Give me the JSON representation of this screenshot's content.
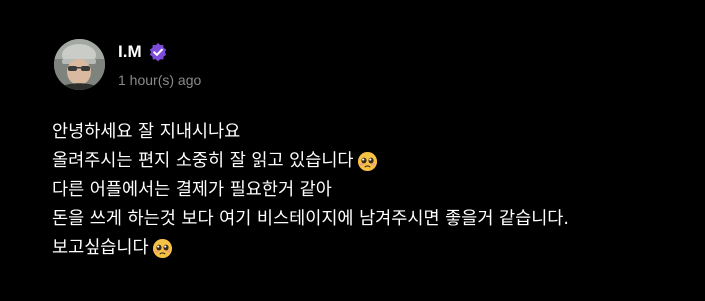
{
  "post": {
    "author": {
      "name": "I.M",
      "verified": true,
      "verified_color": "#7d4cdb"
    },
    "timestamp": "1 hour(s) ago",
    "message": {
      "lines": [
        "안녕하세요 잘 지내시나요",
        "올려주시는 편지 소중히 잘 읽고 있습니다",
        "다른 어플에서는 결제가 필요한거 같아",
        "돈을 쓰게 하는것 보다 여기 비스테이지에 남겨주시면 좋을거 같습니다.",
        "보고싶습니다"
      ],
      "emojis": [
        "pleading-face-icon",
        "pleading-face-icon"
      ]
    }
  }
}
